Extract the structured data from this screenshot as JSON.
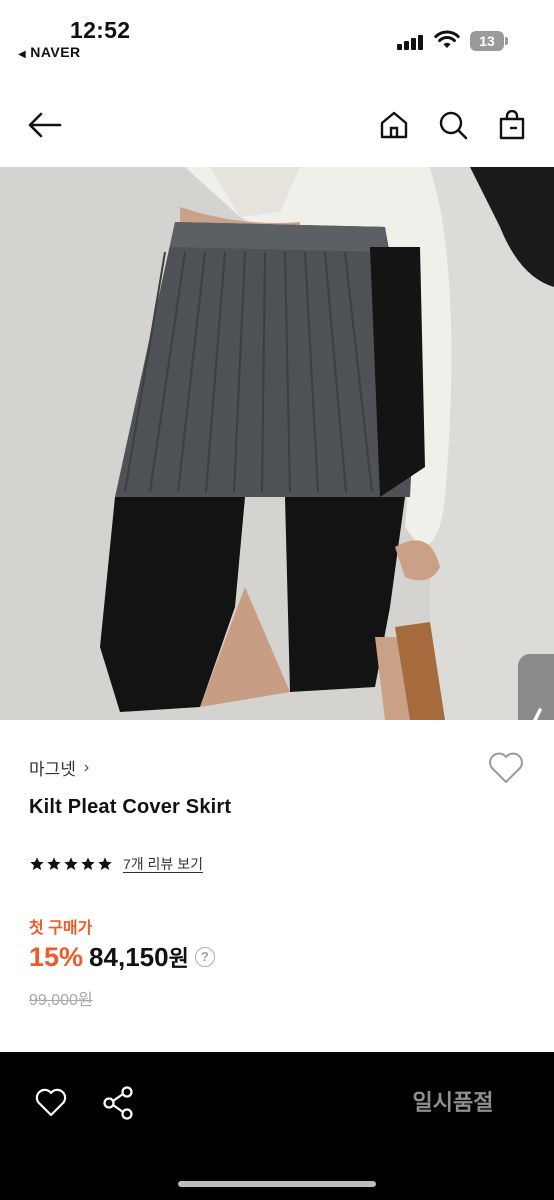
{
  "status_bar": {
    "time": "12:52",
    "back_app": "NAVER",
    "battery": "13",
    "icons": [
      "signal-icon",
      "wifi-icon",
      "battery-icon"
    ]
  },
  "header": {
    "icons": [
      "back-arrow-icon",
      "home-icon",
      "search-icon",
      "shopping-bag-icon"
    ]
  },
  "product": {
    "brand": "마그넷",
    "title": "Kilt Pleat Cover Skirt",
    "rating_stars": 5,
    "review_link": "7개 리뷰 보기",
    "first_purchase_label": "첫 구매가",
    "discount": "15%",
    "price": "84,150",
    "currency": "원",
    "help_icon": "?",
    "original_price": "99,000원"
  },
  "bottom_bar": {
    "buy_button_label": "일시품절",
    "icons": [
      "heart-icon",
      "share-icon"
    ]
  },
  "colors": {
    "accent": "#f05a28",
    "bottom_bar_bg": "#000000",
    "muted": "#a8a8a8"
  }
}
